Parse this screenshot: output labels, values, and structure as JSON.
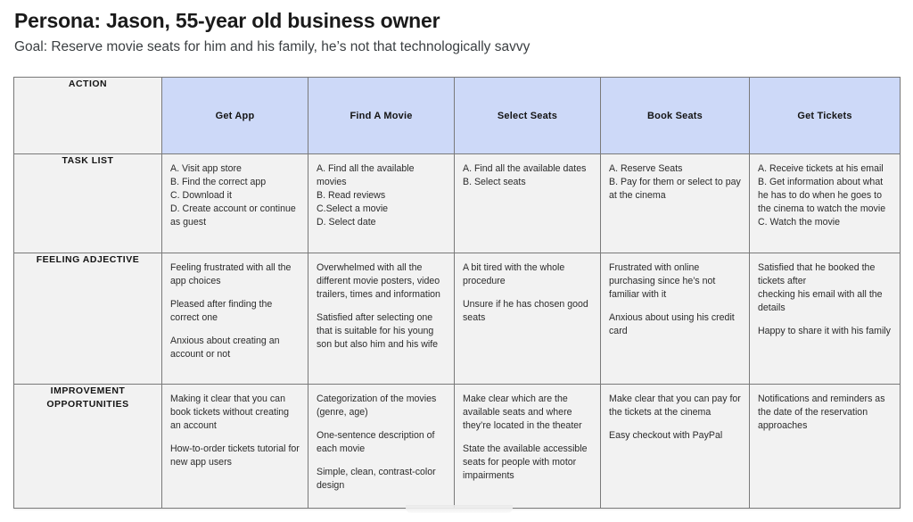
{
  "header": {
    "title": "Persona: Jason, 55-year old business owner",
    "subtitle": "Goal: Reserve movie seats for him and his family, he’s not that technologically savvy"
  },
  "colors": {
    "stage_header_bg": "#cdd9f8",
    "cell_bg": "#f2f2f2",
    "border": "#7a7a7a",
    "title_text": "#1a1a1a",
    "body_text": "#2b2b2b"
  },
  "table": {
    "row_labels": {
      "action": "ACTION",
      "task_list": "TASK LIST",
      "feeling_adjective": "FEELING ADJECTIVE",
      "improvement_opportunities": "IMPROVEMENT\nOPPORTUNITIES"
    },
    "stages": [
      "Get App",
      "Find A Movie",
      "Select Seats",
      "Book Seats",
      "Get Tickets"
    ],
    "task_list": [
      "A. Visit app store\nB. Find the correct app\nC. Download it\nD. Create account or continue as guest",
      "A. Find all the available movies\nB. Read reviews\nC.Select a movie\nD. Select date",
      "A. Find all the available dates\nB. Select seats",
      "A. Reserve Seats\nB. Pay for them or select to pay at the cinema",
      "A. Receive tickets at his email\nB. Get information about what he has to do when he goes to the cinema to watch the movie\nC. Watch the movie"
    ],
    "feeling_adjective": [
      [
        "Feeling frustrated with all the app choices",
        "Pleased after finding the correct one",
        "Anxious about creating an account or not"
      ],
      [
        "Overwhelmed with all the different movie posters, video trailers, times and information",
        "Satisfied after selecting one that is suitable for his young son but also him and his wife"
      ],
      [
        "A bit tired with the whole procedure",
        "Unsure if he has chosen good seats"
      ],
      [
        "Frustrated with online purchasing since he’s not familiar with it",
        "Anxious about using his credit card"
      ],
      [
        "Satisfied that he booked the tickets after\ncheck",
        "Happy to share it with his family"
      ]
    ],
    "feeling_adjective_fixed": [
      [
        "Feeling frustrated with all the app choices",
        "Pleased after finding the correct one",
        "Anxious about creating an account or not"
      ],
      [
        "Overwhelmed with all the different movie posters, video trailers, times and information",
        "Satisfied after selecting one that is suitable for his young son but also him and his wife"
      ],
      [
        "A bit tired with the whole procedure",
        "Unsure if he has chosen good seats"
      ],
      [
        "Frustrated with online purchasing since he’s not familiar with it",
        "Anxious about using his credit card"
      ],
      [
        "Satisfied that he booked the tickets after\nchecking his email with all the details",
        "Happy to share it with his family"
      ]
    ],
    "improvement_opportunities": [
      [
        "Making it clear that you can book tickets without creating an account",
        "How-to-order tickets tutorial for new app users"
      ],
      [
        "Categorization of the movies (genre, age)",
        "One-sentence description of each movie",
        "Simple, clean, contrast-color design"
      ],
      [
        "Make clear which are the available seats and where they’re located in the theater",
        "State the available accessible seats for people with motor impairments"
      ],
      [
        "Make clear that you can pay for the tickets at the cinema",
        "Easy checkout with PayPal"
      ],
      [
        "Notifications and reminders as the date of the reservation approaches"
      ]
    ]
  }
}
